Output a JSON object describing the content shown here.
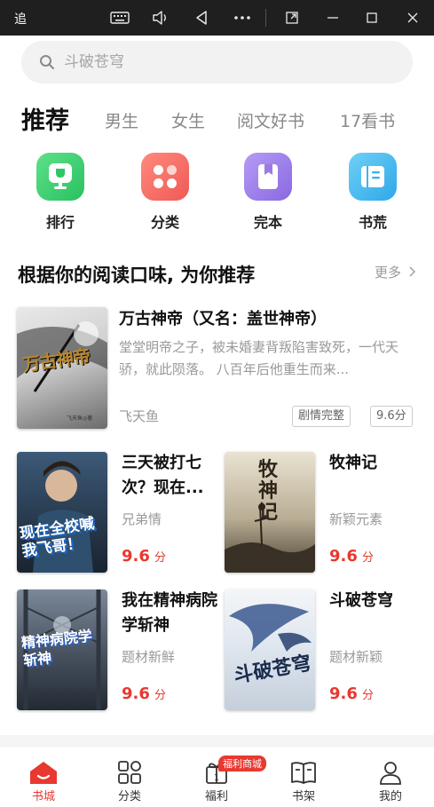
{
  "window": {
    "title": "追"
  },
  "search": {
    "placeholder": "斗破苍穹"
  },
  "tabs": [
    {
      "label": "推荐",
      "active": true
    },
    {
      "label": "男生"
    },
    {
      "label": "女生"
    },
    {
      "label": "阅文好书"
    },
    {
      "label": "17看书"
    }
  ],
  "quick": [
    {
      "label": "排行",
      "icon": "trophy-icon",
      "color": "#34c759"
    },
    {
      "label": "分类",
      "icon": "grid-icon",
      "color": "#f0685f"
    },
    {
      "label": "完本",
      "icon": "book-icon",
      "color": "#9b7be6"
    },
    {
      "label": "书荒",
      "icon": "notebook-icon",
      "color": "#3ab4ee"
    }
  ],
  "section": {
    "title": "根据你的阅读口味, 为你推荐",
    "more": "更多"
  },
  "featured": {
    "title": "万古神帝（又名：盖世神帝）",
    "desc": "堂堂明帝之子，被未婚妻背叛陷害致死，一代天骄，就此陨落。 八百年后他重生而来...",
    "author": "飞天鱼",
    "tag": "剧情完整",
    "score": "9.6分",
    "cover_text": "万古神帝",
    "cover_author": "飞天鱼◎著"
  },
  "books": [
    {
      "title": "三天被打七次？现在...",
      "category": "兄弟情",
      "score": "9.6",
      "unit": "分",
      "cover_text": "现在全校喊我飞哥！"
    },
    {
      "title": "牧神记",
      "category": "新颖元素",
      "score": "9.6",
      "unit": "分",
      "cover_text": "牧神记"
    },
    {
      "title": "我在精神病院学斩神",
      "category": "题材新鲜",
      "score": "9.6",
      "unit": "分",
      "cover_text": "精神病院学斩神"
    },
    {
      "title": "斗破苍穹",
      "category": "题材新颖",
      "score": "9.6",
      "unit": "分",
      "cover_text": "斗破苍穹"
    }
  ],
  "nav": [
    {
      "label": "书城",
      "icon": "home-icon",
      "active": true
    },
    {
      "label": "分类",
      "icon": "category-icon"
    },
    {
      "label": "福利",
      "icon": "gift-icon"
    },
    {
      "label": "书架",
      "icon": "bookshelf-icon"
    },
    {
      "label": "我的",
      "icon": "profile-icon"
    }
  ],
  "nav_badge": "福利商城",
  "colors": {
    "accent": "#e8382f",
    "muted": "#999999"
  }
}
